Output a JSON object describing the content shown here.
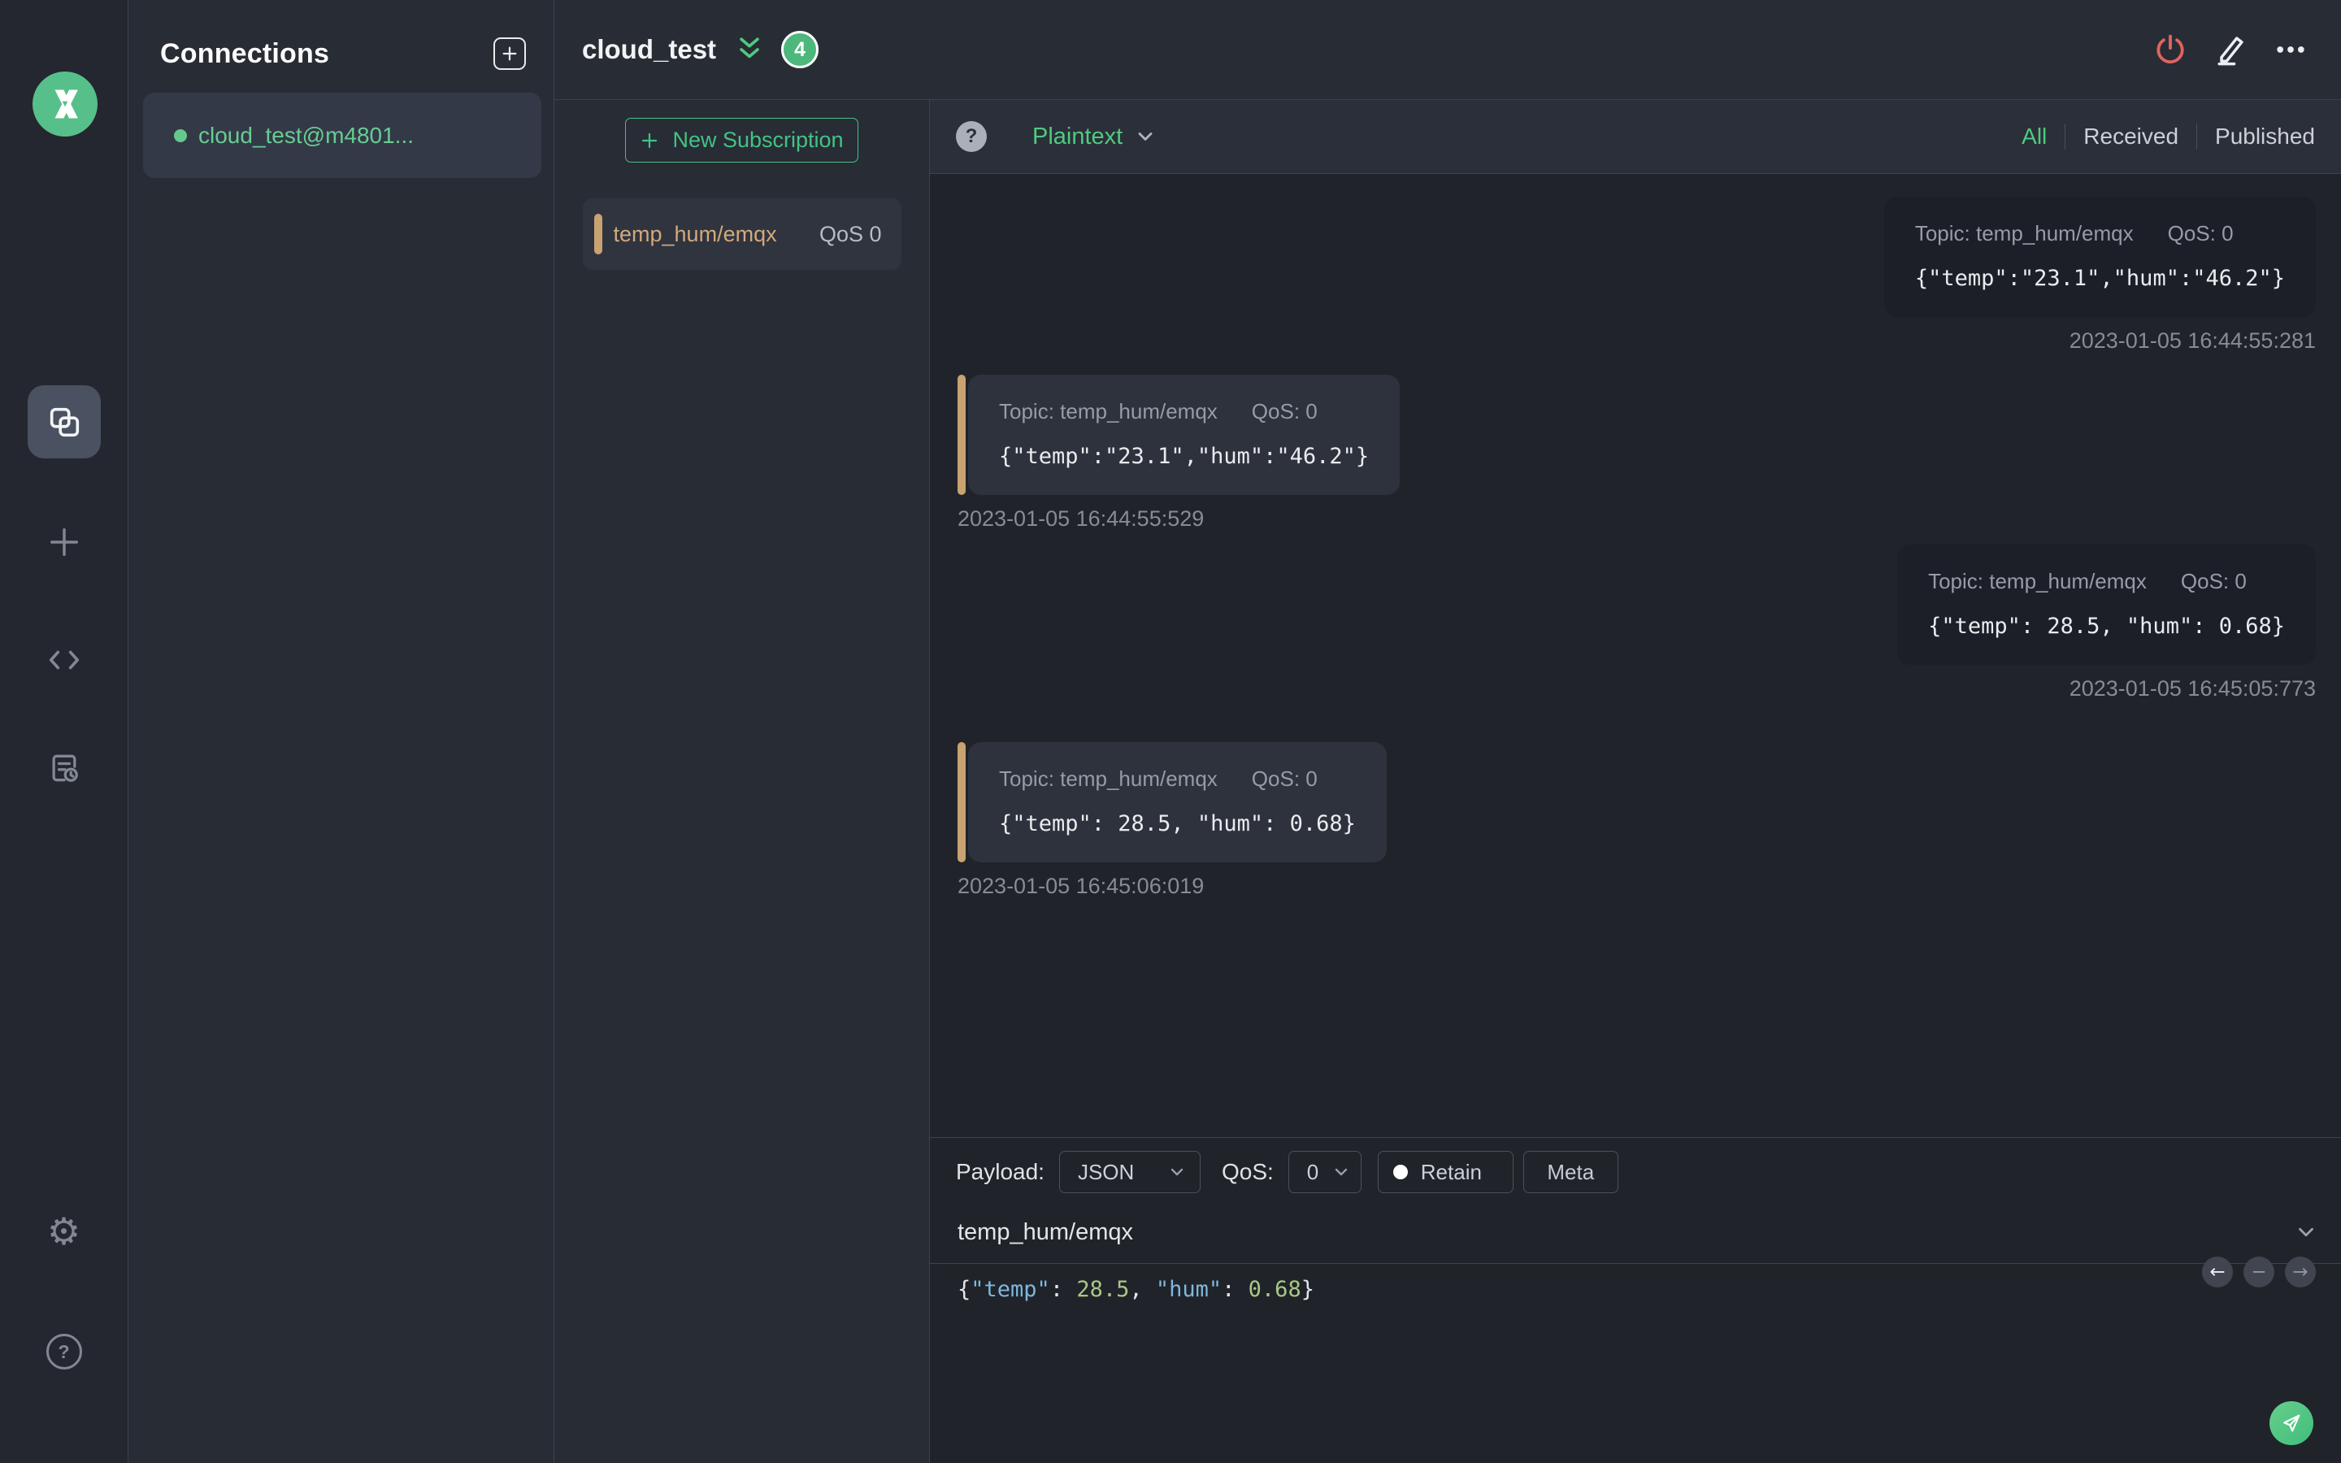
{
  "colors": {
    "brand_green": "#42c385",
    "connection_green": "#67cd92",
    "subscription_accent": "#c9a272",
    "disconnect_red": "#e0645e",
    "json_key_blue": "#7fb7dc",
    "json_number_green": "#a9c786",
    "received_bubble": "#2d323d",
    "published_bubble": "#1c1f27"
  },
  "sidebar": {
    "items": [
      {
        "name": "connections",
        "icon": "overlapping-squares-icon",
        "active": true
      },
      {
        "name": "new-connection",
        "icon": "plus-icon",
        "active": false
      },
      {
        "name": "script",
        "icon": "code-icon",
        "active": false
      },
      {
        "name": "log",
        "icon": "log-icon",
        "active": false
      },
      {
        "name": "settings",
        "icon": "gear-icon",
        "active": false
      },
      {
        "name": "help",
        "icon": "help-circle-icon",
        "active": false
      }
    ]
  },
  "connections": {
    "title": "Connections",
    "items": [
      {
        "name": "cloud_test@m4801...",
        "connected": true
      }
    ]
  },
  "header": {
    "title": "cloud_test",
    "badge_count": "4"
  },
  "subscriptions": {
    "new_button_label": "New Subscription",
    "items": [
      {
        "topic": "temp_hum/emqx",
        "qos": "QoS 0"
      }
    ]
  },
  "messages": {
    "format_label": "Plaintext",
    "filters": [
      {
        "label": "All",
        "active": true
      },
      {
        "label": "Received",
        "active": false
      },
      {
        "label": "Published",
        "active": false
      }
    ],
    "items": [
      {
        "direction": "published",
        "topic_label": "Topic: temp_hum/emqx",
        "qos_label": "QoS: 0",
        "payload": "{\"temp\":\"23.1\",\"hum\":\"46.2\"}",
        "timestamp": "2023-01-05 16:44:55:281"
      },
      {
        "direction": "received",
        "topic_label": "Topic: temp_hum/emqx",
        "qos_label": "QoS: 0",
        "payload": "{\"temp\":\"23.1\",\"hum\":\"46.2\"}",
        "timestamp": "2023-01-05 16:44:55:529"
      },
      {
        "direction": "published",
        "topic_label": "Topic: temp_hum/emqx",
        "qos_label": "QoS: 0",
        "payload": "{\"temp\": 28.5, \"hum\": 0.68}",
        "timestamp": "2023-01-05 16:45:05:773"
      },
      {
        "direction": "received",
        "topic_label": "Topic: temp_hum/emqx",
        "qos_label": "QoS: 0",
        "payload": "{\"temp\": 28.5, \"hum\": 0.68}",
        "timestamp": "2023-01-05 16:45:06:019"
      }
    ]
  },
  "publish": {
    "payload_label": "Payload:",
    "payload_format": "JSON",
    "qos_label": "QoS:",
    "qos_value": "0",
    "retain_label": "Retain",
    "meta_label": "Meta",
    "topic_value": "temp_hum/emqx",
    "payload_tokens": [
      {
        "type": "punct",
        "text": "{"
      },
      {
        "type": "key",
        "text": "\"temp\""
      },
      {
        "type": "punct",
        "text": ": "
      },
      {
        "type": "number",
        "text": "28.5"
      },
      {
        "type": "punct",
        "text": ", "
      },
      {
        "type": "key",
        "text": "\"hum\""
      },
      {
        "type": "punct",
        "text": ": "
      },
      {
        "type": "number",
        "text": "0.68"
      },
      {
        "type": "punct",
        "text": "}"
      }
    ]
  }
}
